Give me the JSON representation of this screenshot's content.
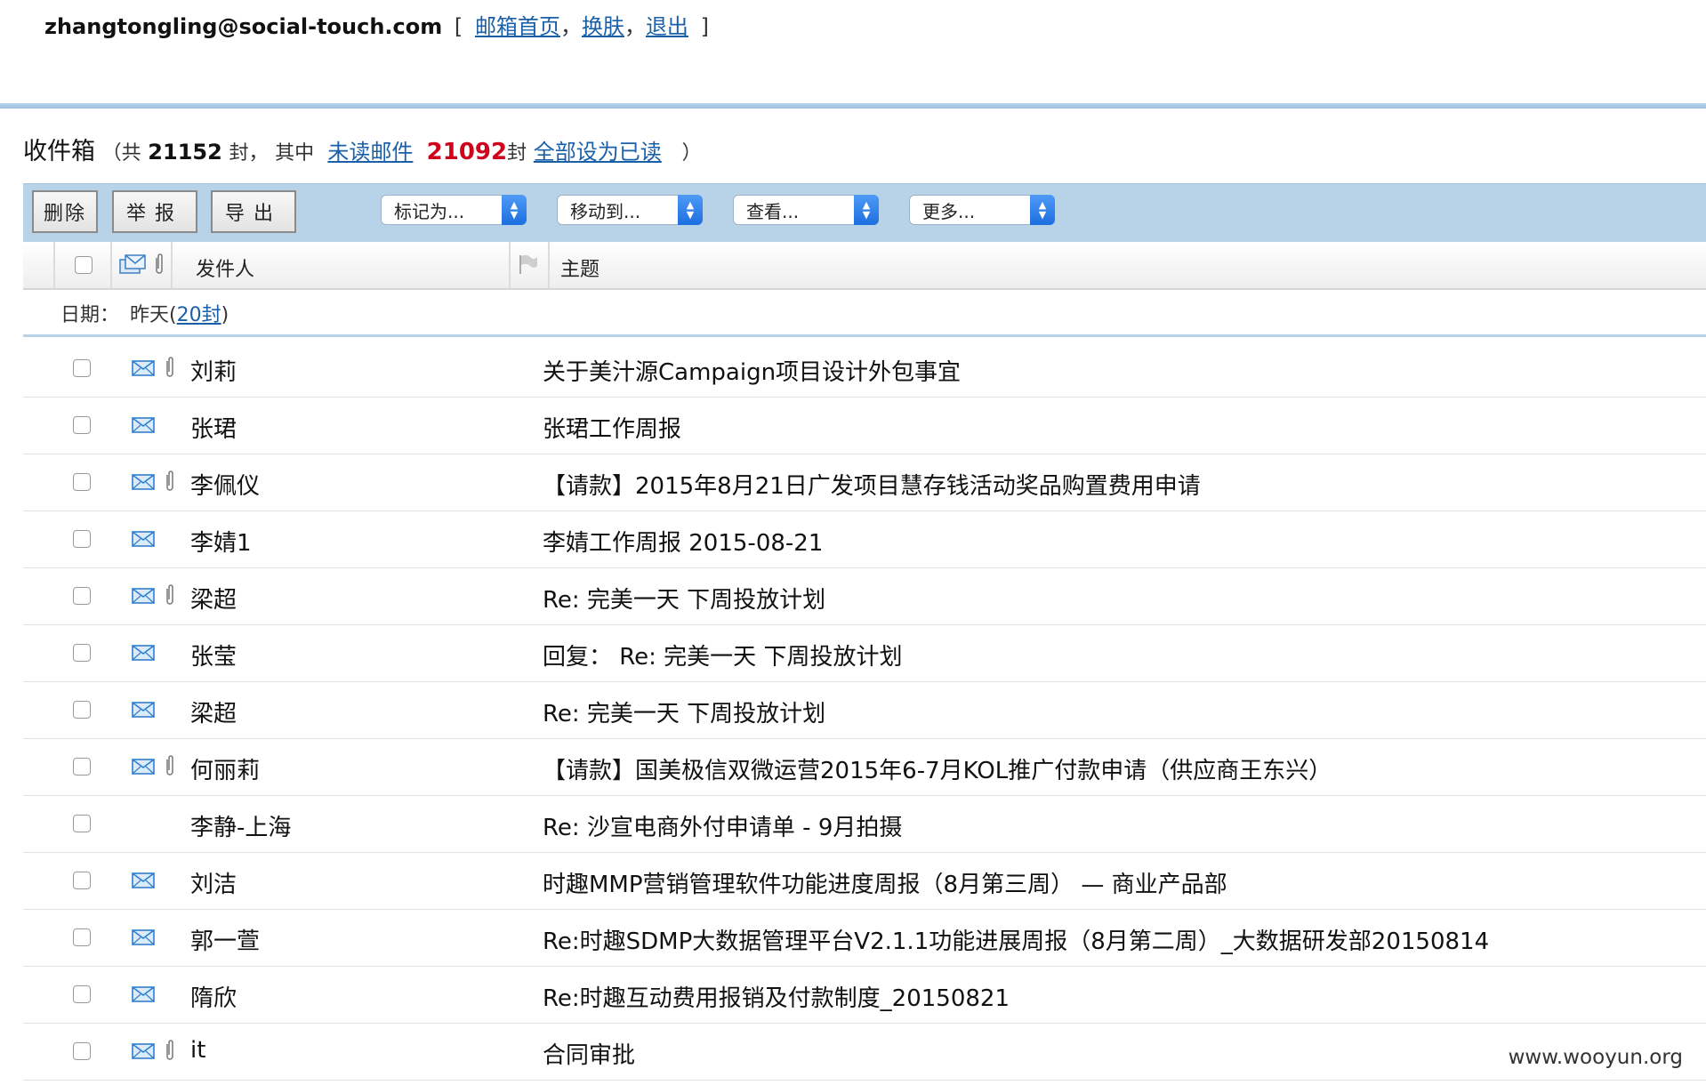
{
  "topbar": {
    "email": "zhangtongling@social-touch.com",
    "links": [
      "邮箱首页",
      "换肤",
      "退出"
    ]
  },
  "summary": {
    "title": "收件箱",
    "open": "（共",
    "total": "21152",
    "unit": "封",
    "comma": "，",
    "among": "其中",
    "unread_link": "未读邮件",
    "unread_count": "21092",
    "unread_unit": "封",
    "mark_all_read": "全部设为已读",
    "close": "）"
  },
  "toolbar": {
    "delete": "删除",
    "report": "举报",
    "export": "导出",
    "mark_as": "标记为...",
    "move_to": "移动到...",
    "view": "查看...",
    "more": "更多..."
  },
  "columns": {
    "sender": "发件人",
    "subject": "主题"
  },
  "date_group": {
    "label": "日期：",
    "value": "昨天",
    "count_open": "(",
    "count": "20封",
    "count_close": ")"
  },
  "emails": [
    {
      "sender": "刘莉",
      "subject": "关于美汁源Campaign项目设计外包事宜",
      "envelope": true,
      "attachment": true,
      "bold": false
    },
    {
      "sender": "张珺",
      "subject": "张珺工作周报",
      "envelope": true,
      "attachment": false,
      "bold": false
    },
    {
      "sender": "李佩仪",
      "subject": "【请款】2015年8月21日广发项目慧存钱活动奖品购置费用申请",
      "envelope": true,
      "attachment": true,
      "bold": false
    },
    {
      "sender": "李婧1",
      "subject": "李婧工作周报  2015-08-21",
      "envelope": true,
      "attachment": false,
      "bold": false
    },
    {
      "sender": "梁超",
      "subject": "Re: 完美一天 下周投放计划",
      "envelope": true,
      "attachment": true,
      "bold": false
    },
    {
      "sender": "张莹",
      "subject": "回复： Re: 完美一天 下周投放计划",
      "envelope": true,
      "attachment": false,
      "bold": false
    },
    {
      "sender": "梁超",
      "subject": "Re: 完美一天 下周投放计划",
      "envelope": true,
      "attachment": false,
      "bold": false
    },
    {
      "sender": "何丽莉",
      "subject": "【请款】国美极信双微运营2015年6-7月KOL推广付款申请（供应商王东兴）",
      "envelope": true,
      "attachment": true,
      "bold": false
    },
    {
      "sender": "李静-上海",
      "subject": "Re: 沙宣电商外付申请单 - 9月拍摄",
      "envelope": false,
      "attachment": false,
      "bold": false
    },
    {
      "sender": "刘洁",
      "subject": "时趣MMP营销管理软件功能进度周报（8月第三周） — 商业产品部",
      "envelope": true,
      "attachment": false,
      "bold": false
    },
    {
      "sender": "郭一萱",
      "subject": "Re:时趣SDMP大数据管理平台V2.1.1功能进展周报（8月第二周）_大数据研发部20150814",
      "envelope": true,
      "attachment": false,
      "bold": false
    },
    {
      "sender": "隋欣",
      "subject": "Re:时趣互动费用报销及付款制度_20150821",
      "envelope": true,
      "attachment": false,
      "bold": false
    },
    {
      "sender": "it",
      "subject": "合同审批",
      "envelope": true,
      "attachment": true,
      "bold": false
    }
  ],
  "watermark": "www.wooyun.org"
}
